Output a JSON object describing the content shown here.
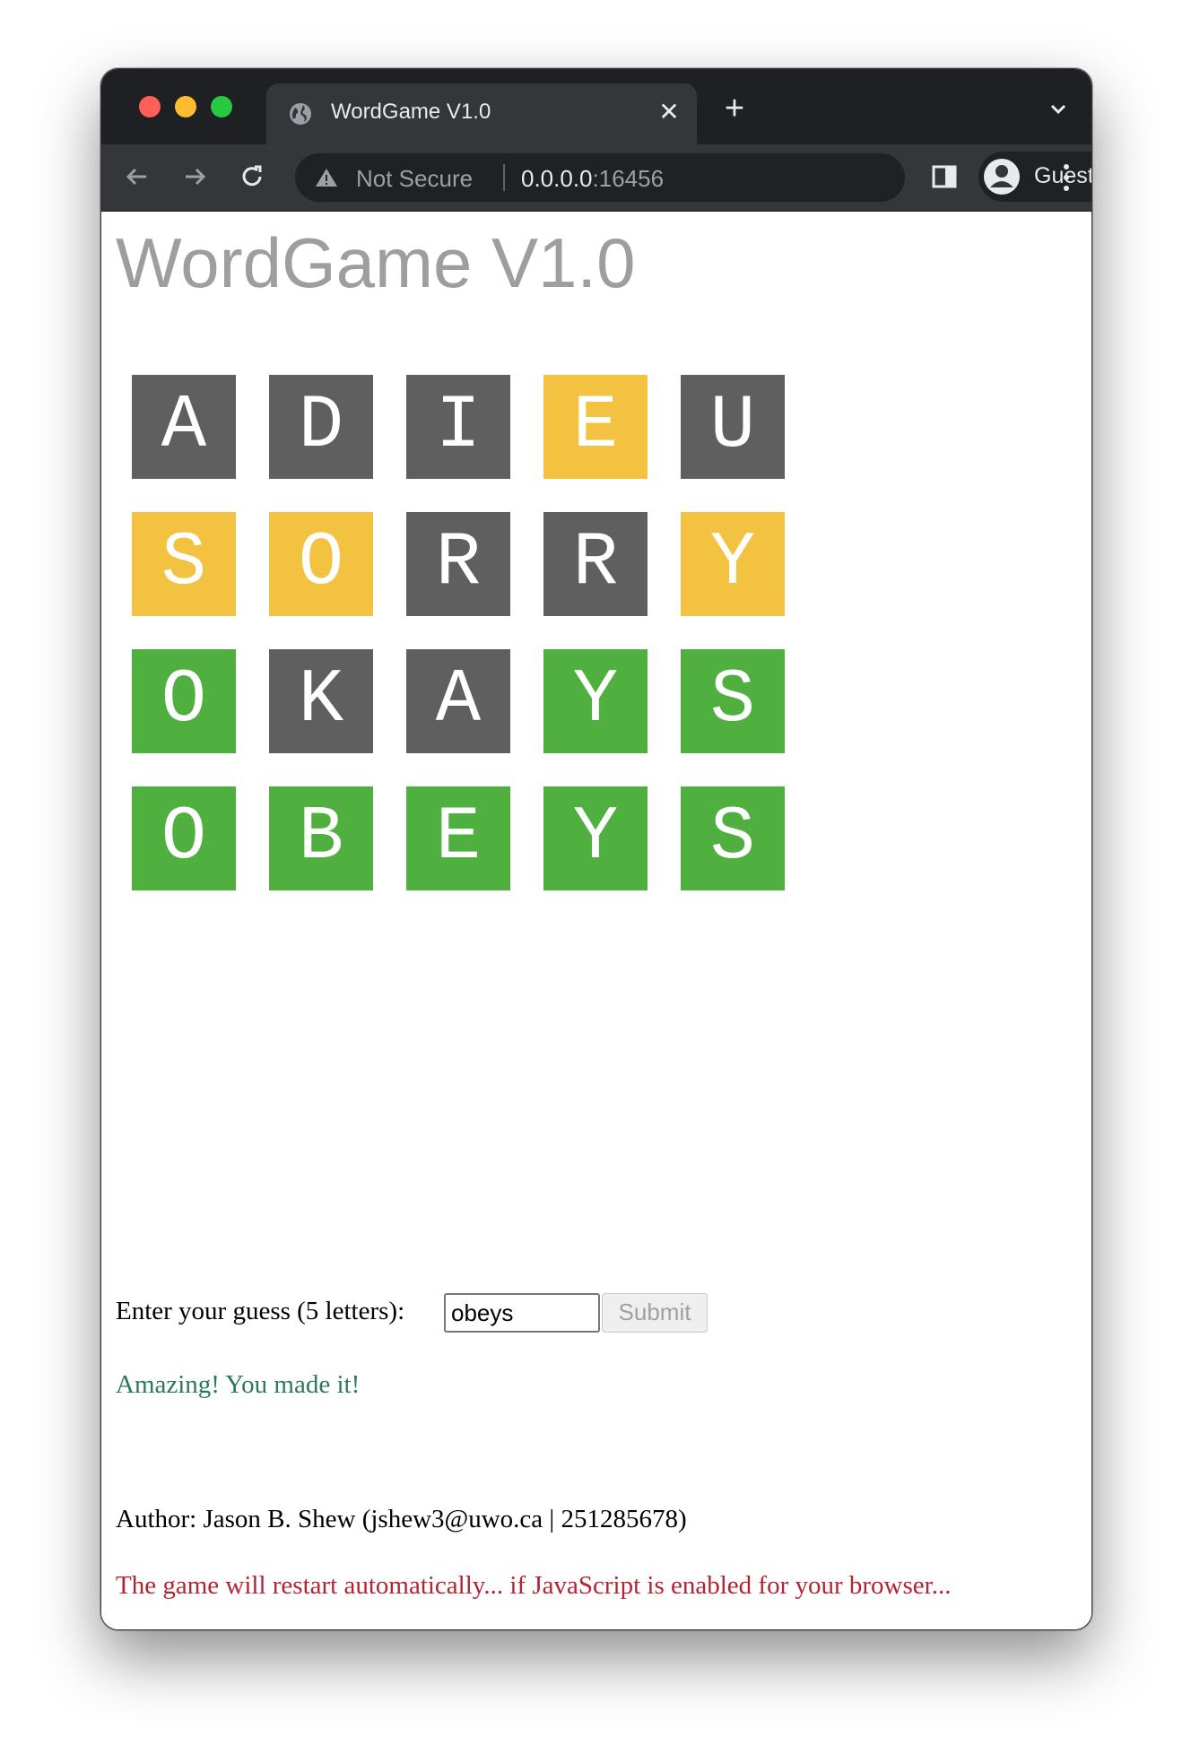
{
  "browser": {
    "tab_title": "WordGame V1.0",
    "tab_close": "✕",
    "new_tab": "+",
    "security_label": "Not Secure",
    "url_host": "0.0.0.0",
    "url_port": ":16456",
    "profile_label": "Guest"
  },
  "page": {
    "title": "WordGame V1.0"
  },
  "colors": {
    "absent": "#5f5f5f",
    "present": "#f2c240",
    "correct": "#4fb040"
  },
  "board": {
    "rows": [
      [
        {
          "letter": "A",
          "state": "absent"
        },
        {
          "letter": "D",
          "state": "absent"
        },
        {
          "letter": "I",
          "state": "absent"
        },
        {
          "letter": "E",
          "state": "present"
        },
        {
          "letter": "U",
          "state": "absent"
        }
      ],
      [
        {
          "letter": "S",
          "state": "present"
        },
        {
          "letter": "O",
          "state": "present"
        },
        {
          "letter": "R",
          "state": "absent"
        },
        {
          "letter": "R",
          "state": "absent"
        },
        {
          "letter": "Y",
          "state": "present"
        }
      ],
      [
        {
          "letter": "O",
          "state": "correct"
        },
        {
          "letter": "K",
          "state": "absent"
        },
        {
          "letter": "A",
          "state": "absent"
        },
        {
          "letter": "Y",
          "state": "correct"
        },
        {
          "letter": "S",
          "state": "correct"
        }
      ],
      [
        {
          "letter": "O",
          "state": "correct"
        },
        {
          "letter": "B",
          "state": "correct"
        },
        {
          "letter": "E",
          "state": "correct"
        },
        {
          "letter": "Y",
          "state": "correct"
        },
        {
          "letter": "S",
          "state": "correct"
        }
      ]
    ]
  },
  "form": {
    "label": "Enter your guess (5 letters):",
    "value": "obeys",
    "submit_label": "Submit"
  },
  "messages": {
    "result": "Amazing! You made it!",
    "author": "Author: Jason B. Shew (jshew3@uwo.ca | 251285678)",
    "restart": "The game will restart automatically... if JavaScript is enabled for your browser..."
  }
}
